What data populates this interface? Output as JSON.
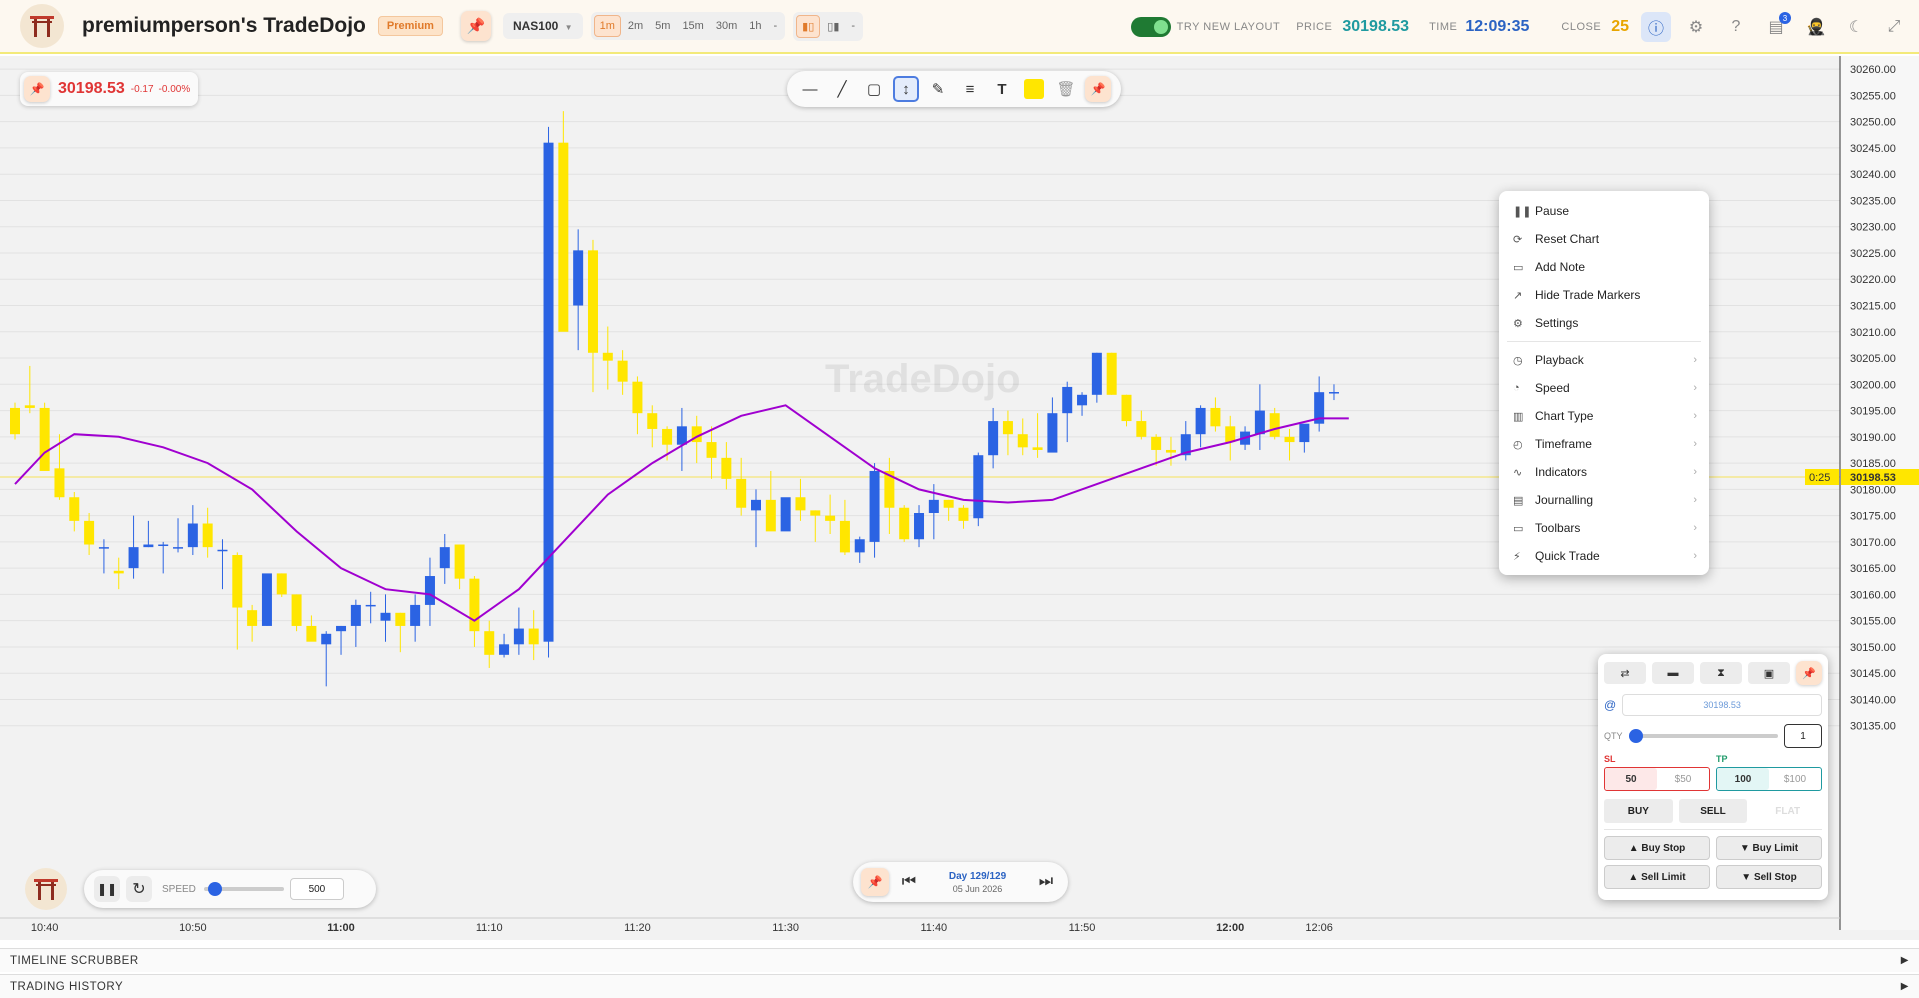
{
  "header": {
    "app_title": "premiumperson's TradeDojo",
    "badge": "Premium",
    "symbol": "NAS100",
    "timeframes": [
      "1m",
      "2m",
      "5m",
      "15m",
      "30m",
      "1h",
      "-"
    ],
    "active_timeframe": "1m",
    "toggle_label": "TRY NEW LAYOUT",
    "price_label": "PRICE",
    "price_value": "30198.53",
    "time_label": "TIME",
    "time_value": "12:09:35",
    "close_label": "CLOSE",
    "close_value": "25",
    "notification_count": "3",
    "icons": [
      "info-icon",
      "gear-icon",
      "help-icon",
      "notes-icon",
      "avatar-icon",
      "moon-icon",
      "fullscreen-icon"
    ]
  },
  "price_info": {
    "price": "30198.53",
    "change": "-0.17",
    "change_pct": "-0.00%"
  },
  "draw_tools": [
    "horizontal-line-icon",
    "trendline-icon",
    "rectangle-icon",
    "measure-icon",
    "pen-icon",
    "lines-icon",
    "text-icon",
    "color-swatch",
    "trash-icon",
    "pin-icon"
  ],
  "context_menu": {
    "group1": [
      {
        "icon": "pause-icon",
        "label": "Pause"
      },
      {
        "icon": "reset-icon",
        "label": "Reset Chart"
      },
      {
        "icon": "note-icon",
        "label": "Add Note"
      },
      {
        "icon": "markers-icon",
        "label": "Hide Trade Markers"
      },
      {
        "icon": "gear-icon",
        "label": "Settings"
      }
    ],
    "group2": [
      {
        "icon": "playback-icon",
        "label": "Playback"
      },
      {
        "icon": "speed-icon",
        "label": "Speed"
      },
      {
        "icon": "chart-type-icon",
        "label": "Chart Type"
      },
      {
        "icon": "clock-icon",
        "label": "Timeframe"
      },
      {
        "icon": "indicators-icon",
        "label": "Indicators"
      },
      {
        "icon": "journal-icon",
        "label": "Journalling"
      },
      {
        "icon": "toolbars-icon",
        "label": "Toolbars"
      },
      {
        "icon": "bolt-icon",
        "label": "Quick Trade"
      }
    ]
  },
  "trade_panel": {
    "at_symbol": "@",
    "price_placeholder": "30198.53",
    "qty_label": "QTY",
    "qty_value": "1",
    "sl_label": "SL",
    "tp_label": "TP",
    "sl_values": [
      "50",
      "$50"
    ],
    "tp_values": [
      "100",
      "$100"
    ],
    "buy_label": "BUY",
    "sell_label": "SELL",
    "flat_label": "FLAT",
    "buy_stop": "▲ Buy Stop",
    "buy_limit": "▼ Buy Limit",
    "sell_limit": "▲ Sell Limit",
    "sell_stop": "▼ Sell Stop"
  },
  "playback": {
    "speed_label": "SPEED",
    "speed_value": "500",
    "day_label": "Day 129/129",
    "date_label": "05 Jun 2026"
  },
  "footer": {
    "timeline": "TIMELINE SCRUBBER",
    "history": "TRADING HISTORY"
  },
  "chart_data": {
    "type": "candlestick",
    "symbol": "NAS100",
    "timeframe": "1m",
    "watermark": "TradeDojo",
    "ylim": [
      30130,
      30262.5
    ],
    "y_ticks": [
      "30260.00",
      "30255.00",
      "30250.00",
      "30245.00",
      "30240.00",
      "30235.00",
      "30230.00",
      "30225.00",
      "30220.00",
      "30215.00",
      "30210.00",
      "30205.00",
      "30200.00",
      "30195.00",
      "30190.00",
      "30185.00",
      "30180.00",
      "30175.00",
      "30170.00",
      "30165.00",
      "30160.00",
      "30155.00",
      "30150.00",
      "30145.00",
      "30140.00",
      "30135.00"
    ],
    "x_ticks": [
      {
        "label": "10:40",
        "minute": 640,
        "bold": false
      },
      {
        "label": "10:50",
        "minute": 650,
        "bold": false
      },
      {
        "label": "11:00",
        "minute": 660,
        "bold": true
      },
      {
        "label": "11:10",
        "minute": 670,
        "bold": false
      },
      {
        "label": "11:20",
        "minute": 680,
        "bold": false
      },
      {
        "label": "11:30",
        "minute": 690,
        "bold": false
      },
      {
        "label": "11:40",
        "minute": 700,
        "bold": false
      },
      {
        "label": "11:50",
        "minute": 710,
        "bold": false
      },
      {
        "label": "12:00",
        "minute": 720,
        "bold": true
      },
      {
        "label": "12:06",
        "minute": 726,
        "bold": false
      }
    ],
    "first_candle_minute": 638,
    "last_price": "30198.53",
    "countdown": "0:25",
    "up_color": "#2b63e3",
    "down_color": "#ffe600",
    "ma_color": "#a000d0",
    "candles": [
      [
        30195.5,
        30196.5,
        30189.5,
        30190.5
      ],
      [
        30196.0,
        30203.5,
        30194.5,
        30195.5
      ],
      [
        30195.5,
        30196.5,
        30185.0,
        30183.5
      ],
      [
        30184.0,
        30190.5,
        30178.0,
        30178.5
      ],
      [
        30178.5,
        30179.5,
        30172.0,
        30174.0
      ],
      [
        30174.0,
        30175.5,
        30167.5,
        30169.5
      ],
      [
        30169.0,
        30170.5,
        30164.0,
        30169.0
      ],
      [
        30164.5,
        30167.0,
        30161.0,
        30164.0
      ],
      [
        30165.0,
        30175.0,
        30163.0,
        30169.0
      ],
      [
        30169.0,
        30174.0,
        30169.0,
        30169.5
      ],
      [
        30169.5,
        30170.0,
        30164.0,
        30169.5
      ],
      [
        30169.0,
        30174.5,
        30168.0,
        30169.0
      ],
      [
        30169.0,
        30177.0,
        30167.5,
        30173.5
      ],
      [
        30173.5,
        30176.5,
        30167.0,
        30169.0
      ],
      [
        30168.5,
        30170.5,
        30161.0,
        30168.5
      ],
      [
        30167.5,
        30168.0,
        30149.5,
        30157.5
      ],
      [
        30157.0,
        30158.0,
        30151.0,
        30154.0
      ],
      [
        30154.0,
        30161.5,
        30154.0,
        30164.0
      ],
      [
        30164.0,
        30164.0,
        30159.5,
        30160.0
      ],
      [
        30160.0,
        30160.0,
        30153.0,
        30154.0
      ],
      [
        30154.0,
        30156.0,
        30151.5,
        30151.0
      ],
      [
        30150.5,
        30153.0,
        30142.5,
        30152.5
      ],
      [
        30153.0,
        30154.0,
        30148.5,
        30154.0
      ],
      [
        30154.0,
        30159.0,
        30150.0,
        30158.0
      ],
      [
        30158.0,
        30160.5,
        30154.5,
        30158.0
      ],
      [
        30155.0,
        30160.0,
        30151.0,
        30156.5
      ],
      [
        30156.5,
        30156.5,
        30149.0,
        30154.0
      ],
      [
        30154.0,
        30160.0,
        30151.0,
        30158.0
      ],
      [
        30158.0,
        30167.0,
        30154.0,
        30163.5
      ],
      [
        30165.0,
        30171.5,
        30162.0,
        30169.0
      ],
      [
        30169.5,
        30169.5,
        30161.0,
        30163.0
      ],
      [
        30163.0,
        30163.5,
        30150.0,
        30153.0
      ],
      [
        30153.0,
        30155.0,
        30146.0,
        30148.5
      ],
      [
        30148.5,
        30152.5,
        30148.0,
        30150.5
      ],
      [
        30150.5,
        30157.5,
        30148.5,
        30153.5
      ],
      [
        30153.5,
        30157.0,
        30147.5,
        30150.5
      ],
      [
        30151.0,
        30249.0,
        30148.0,
        30246.0
      ],
      [
        30246.0,
        30252.0,
        30225.0,
        30210.0
      ],
      [
        30215.0,
        30229.5,
        30206.5,
        30225.5
      ],
      [
        30225.5,
        30227.5,
        30198.5,
        30206.0
      ],
      [
        30206.0,
        30211.0,
        30199.0,
        30204.5
      ],
      [
        30204.5,
        30206.5,
        30198.0,
        30200.5
      ],
      [
        30200.5,
        30201.5,
        30190.5,
        30194.5
      ],
      [
        30194.5,
        30196.0,
        30188.0,
        30191.5
      ],
      [
        30191.5,
        30192.0,
        30185.5,
        30188.5
      ],
      [
        30188.5,
        30195.5,
        30183.5,
        30192.0
      ],
      [
        30192.0,
        30194.0,
        30185.0,
        30189.0
      ],
      [
        30189.0,
        30192.0,
        30182.0,
        30186.0
      ],
      [
        30186.0,
        30189.0,
        30180.0,
        30182.0
      ],
      [
        30182.0,
        30186.0,
        30175.0,
        30176.5
      ],
      [
        30176.0,
        30180.0,
        30169.0,
        30178.0
      ],
      [
        30178.0,
        30183.5,
        30172.5,
        30172.0
      ],
      [
        30172.0,
        30178.0,
        30172.5,
        30178.5
      ],
      [
        30178.5,
        30182.0,
        30174.0,
        30176.0
      ],
      [
        30176.0,
        30176.0,
        30170.0,
        30175.0
      ],
      [
        30175.0,
        30179.0,
        30171.5,
        30174.0
      ],
      [
        30174.0,
        30178.0,
        30167.5,
        30168.0
      ],
      [
        30168.0,
        30171.0,
        30166.0,
        30170.5
      ],
      [
        30170.0,
        30185.0,
        30167.0,
        30183.5
      ],
      [
        30183.5,
        30186.0,
        30171.5,
        30176.5
      ],
      [
        30176.5,
        30177.0,
        30170.0,
        30170.5
      ],
      [
        30170.5,
        30177.0,
        30169.0,
        30175.5
      ],
      [
        30175.5,
        30181.0,
        30170.5,
        30178.0
      ],
      [
        30178.0,
        30178.0,
        30174.0,
        30176.5
      ],
      [
        30176.5,
        30177.0,
        30172.5,
        30174.0
      ],
      [
        30174.5,
        30187.0,
        30173.0,
        30186.5
      ],
      [
        30186.5,
        30195.5,
        30184.0,
        30193.0
      ],
      [
        30193.0,
        30195.0,
        30186.5,
        30190.5
      ],
      [
        30190.5,
        30193.5,
        30186.5,
        30188.0
      ],
      [
        30188.0,
        30194.5,
        30186.0,
        30187.5
      ],
      [
        30187.0,
        30197.5,
        30187.5,
        30194.5
      ],
      [
        30194.5,
        30200.5,
        30189.0,
        30199.5
      ],
      [
        30196.0,
        30198.5,
        30194.0,
        30198.0
      ],
      [
        30198.0,
        30206.0,
        30196.5,
        30206.0
      ],
      [
        30206.0,
        30206.0,
        30198.0,
        30198.0
      ],
      [
        30198.0,
        30198.0,
        30192.0,
        30193.0
      ],
      [
        30193.0,
        30195.0,
        30189.5,
        30190.0
      ],
      [
        30190.0,
        30190.5,
        30184.5,
        30187.5
      ],
      [
        30187.5,
        30190.0,
        30184.5,
        30187.0
      ],
      [
        30186.5,
        30193.0,
        30185.5,
        30190.5
      ],
      [
        30190.5,
        30196.0,
        30188.0,
        30195.5
      ],
      [
        30195.5,
        30197.5,
        30191.0,
        30192.0
      ],
      [
        30192.0,
        30194.0,
        30185.5,
        30189.0
      ],
      [
        30188.5,
        30192.0,
        30187.5,
        30191.0
      ],
      [
        30190.5,
        30200.0,
        30187.5,
        30195.0
      ],
      [
        30194.5,
        30195.5,
        30189.5,
        30190.0
      ],
      [
        30190.0,
        30191.5,
        30185.5,
        30189.0
      ],
      [
        30189.0,
        30192.0,
        30187.0,
        30192.5
      ],
      [
        30192.5,
        30201.5,
        30191.0,
        30198.5
      ],
      [
        30198.5,
        30200.0,
        30197.0,
        30198.53
      ]
    ],
    "ma": [
      [
        638,
        30181
      ],
      [
        640,
        30187
      ],
      [
        642,
        30190.5
      ],
      [
        645,
        30190
      ],
      [
        648,
        30188
      ],
      [
        651,
        30185
      ],
      [
        654,
        30180
      ],
      [
        657,
        30172
      ],
      [
        660,
        30165
      ],
      [
        663,
        30161
      ],
      [
        666,
        30160
      ],
      [
        669,
        30155
      ],
      [
        672,
        30161
      ],
      [
        675,
        30170
      ],
      [
        678,
        30179
      ],
      [
        681,
        30185
      ],
      [
        684,
        30190
      ],
      [
        687,
        30194
      ],
      [
        690,
        30196
      ],
      [
        693,
        30190
      ],
      [
        696,
        30184
      ],
      [
        699,
        30180
      ],
      [
        702,
        30178
      ],
      [
        705,
        30177.5
      ],
      [
        708,
        30178
      ],
      [
        711,
        30181
      ],
      [
        714,
        30184
      ],
      [
        717,
        30187
      ],
      [
        720,
        30189
      ],
      [
        723,
        30191.5
      ],
      [
        726,
        30193.5
      ],
      [
        728,
        30193.5
      ]
    ]
  }
}
